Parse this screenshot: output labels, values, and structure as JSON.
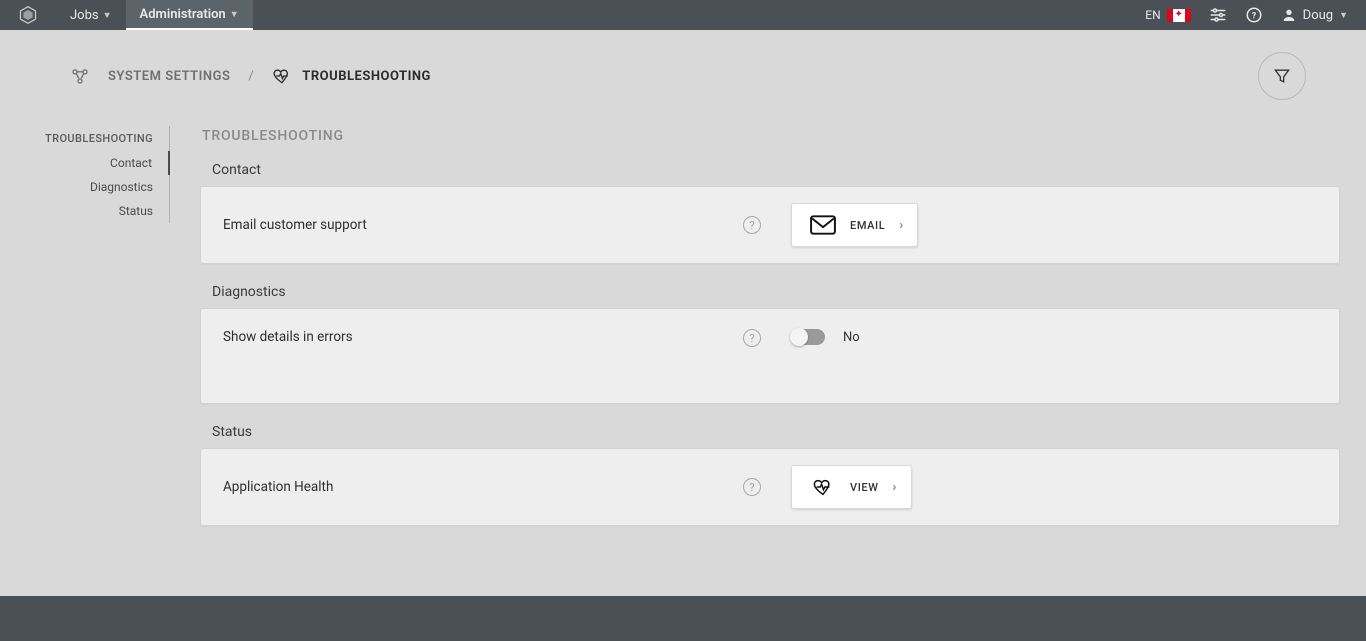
{
  "header": {
    "nav": {
      "jobs": "Jobs",
      "administration": "Administration"
    },
    "lang_code": "EN",
    "user_name": "Doug"
  },
  "breadcrumb": {
    "root": "SYSTEM SETTINGS",
    "separator": "/",
    "current": "TROUBLESHOOTING"
  },
  "sidenav": {
    "heading": "TROUBLESHOOTING",
    "items": [
      "Contact",
      "Diagnostics",
      "Status"
    ]
  },
  "panel": {
    "title": "TROUBLESHOOTING",
    "sections": {
      "contact": {
        "label": "Contact",
        "row_label": "Email customer support",
        "button_label": "EMAIL"
      },
      "diagnostics": {
        "label": "Diagnostics",
        "row_label": "Show details in errors",
        "toggle_state": "No"
      },
      "status": {
        "label": "Status",
        "row_label": "Application Health",
        "button_label": "VIEW"
      }
    }
  }
}
